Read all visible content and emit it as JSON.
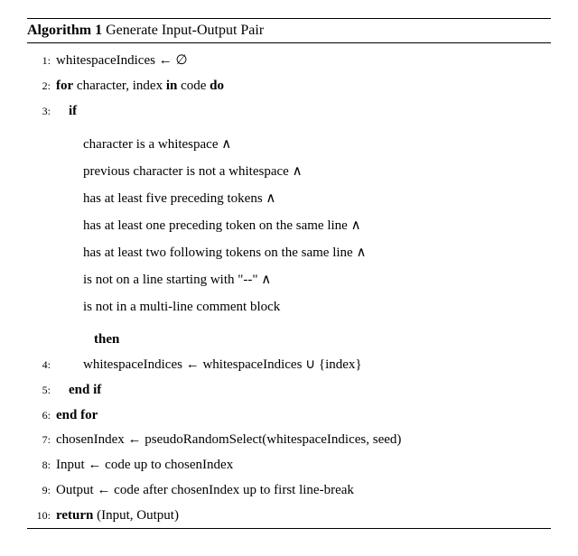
{
  "header": {
    "number": "Algorithm 1",
    "title": "Generate Input-Output Pair"
  },
  "lines": {
    "l1": "whitespaceIndices ← ∅",
    "l2a": "for",
    "l2b": "character, index",
    "l2c": "in",
    "l2d": "code",
    "l2e": "do",
    "l3": "if",
    "c1": "character is a whitespace ∧",
    "c2": "previous character is not a whitespace ∧",
    "c3": "has at least five preceding tokens ∧",
    "c4": "has at least one preceding token on the same line ∧",
    "c5": "has at least two following tokens on the same line ∧",
    "c6": "is not on a line starting with \"--\" ∧",
    "c7": "is not in a multi-line comment block",
    "then": "then",
    "l4": "whitespaceIndices ← whitespaceIndices ∪ {index}",
    "l5": "end if",
    "l6": "end for",
    "l7": "chosenIndex ← pseudoRandomSelect(whitespaceIndices, seed)",
    "l8": "Input ← code up to chosenIndex",
    "l9": "Output ← code after chosenIndex up to first line-break",
    "l10a": "return",
    "l10b": "(Input, Output)"
  },
  "nums": {
    "n1": "1:",
    "n2": "2:",
    "n3": "3:",
    "n4": "4:",
    "n5": "5:",
    "n6": "6:",
    "n7": "7:",
    "n8": "8:",
    "n9": "9:",
    "n10": "10:"
  }
}
